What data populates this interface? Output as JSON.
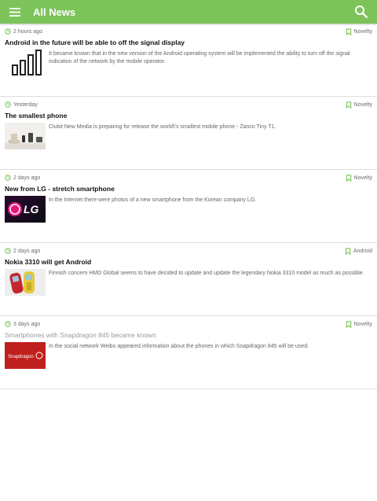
{
  "app_bar": {
    "title": "All News",
    "menu_icon": "hamburger-menu-icon",
    "search_icon": "search-icon",
    "color": "#7cc35a"
  },
  "news": [
    {
      "time": "2 hours ago",
      "category": "Novelty",
      "title": "Android in the future will be able to off the signal display",
      "summary": "It became known that in the new version of the Android operating system will be implemented the ability to turn off the signal indication of the network by the mobile operator.",
      "thumbnail": "signal-bars-image"
    },
    {
      "time": "Yesterday",
      "category": "Novelty",
      "title": "The smallest phone",
      "summary": "Clubit New Media is preparing for release the world\\'s smallest mobile phone - Zanco Tiny T1.",
      "thumbnail": "small-phone-image"
    },
    {
      "time": "2 days ago",
      "category": "Novelty",
      "title": "New from LG - stretch smartphone",
      "summary": "In the Internet there were photos of a new smartphone from the Korean company LG.",
      "thumbnail": "lg-logo-image"
    },
    {
      "time": "2 days ago",
      "category": "Android",
      "title": "Nokia 3310 will get Android",
      "summary": "Finnish concern HMD Global seems to have decided to update and update the legendary Nokia 3310 model as much as possible.",
      "thumbnail": "nokia-phones-image"
    },
    {
      "time": "3 days ago",
      "category": "Novelty",
      "title": "Smartphones with Snapdragon 845 became known",
      "summary": "In the social network Weibo appeared information about the phones in which Snapdragon 845 will be used.",
      "thumbnail": "snapdragon-image",
      "thumbnail_text": "Snapdragon"
    }
  ],
  "icons": {
    "time": "clock-icon",
    "category": "bookmark-icon"
  },
  "colors": {
    "accent": "#7cc35a",
    "divider": "#dddddd"
  }
}
